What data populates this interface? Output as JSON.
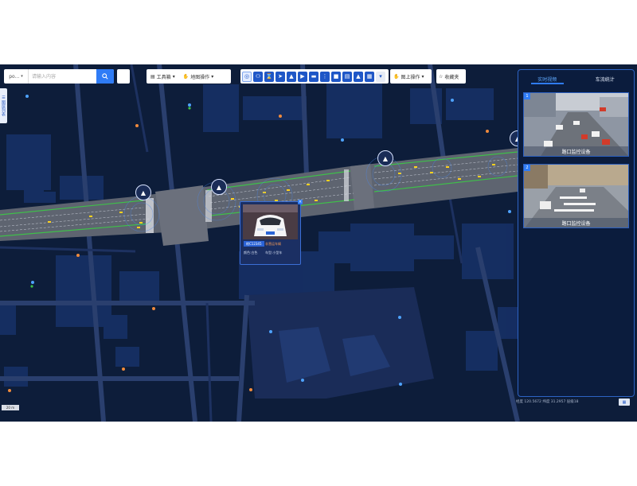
{
  "search": {
    "scope_value": "po...",
    "placeholder": "请输入内容"
  },
  "toolbar": {
    "toolbox_label": "工具箱",
    "map_ops_label": "地图操作",
    "overlay_ops_label": "图上操作",
    "favorites_label": "收藏夹"
  },
  "left_tab": {
    "label": "图层列表"
  },
  "popup": {
    "plate": "皖C12345",
    "vehicle_type": "非营运车辆",
    "color_label": "颜色:白色",
    "model_label": "车型:小型车"
  },
  "panel": {
    "tabs": [
      {
        "label": "实时视频",
        "active": true
      },
      {
        "label": "车流统计",
        "active": false
      }
    ],
    "feeds": [
      {
        "index": "1",
        "caption": "路口监控设备"
      },
      {
        "index": "2",
        "caption": "路口监控设备"
      }
    ]
  },
  "status": {
    "coords": "经度 120.5672 纬度 31.2957 层级18"
  },
  "scale_bar": "20 m",
  "colors": {
    "map_bg": "#0d1d3a",
    "accent": "#2f7cf6",
    "road_green": "#37b34a",
    "panel_border": "#2d63c4"
  }
}
